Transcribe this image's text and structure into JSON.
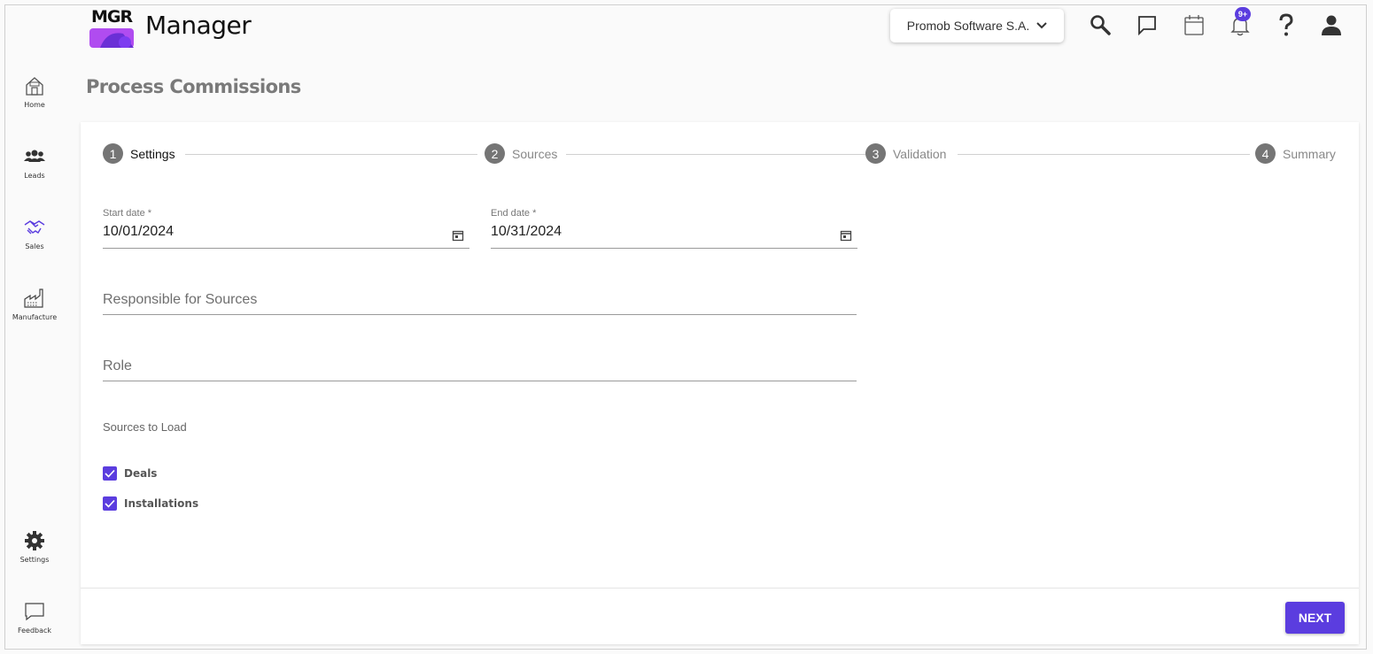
{
  "app": {
    "logo_text": "MGR",
    "title": "Manager"
  },
  "header": {
    "company": "Promob Software S.A.",
    "notification_badge": "9+"
  },
  "sidebar": {
    "items": [
      {
        "label": "Home",
        "icon": "home-icon"
      },
      {
        "label": "Leads",
        "icon": "people-icon"
      },
      {
        "label": "Sales",
        "icon": "handshake-icon"
      },
      {
        "label": "Manufacture",
        "icon": "factory-icon"
      },
      {
        "label": "Settings",
        "icon": "gear-icon"
      },
      {
        "label": "Feedback",
        "icon": "chat-bubble-icon"
      }
    ]
  },
  "page": {
    "title": "Process Commissions"
  },
  "stepper": {
    "steps": [
      {
        "number": "1",
        "label": "Settings",
        "active": true
      },
      {
        "number": "2",
        "label": "Sources",
        "active": false
      },
      {
        "number": "3",
        "label": "Validation",
        "active": false
      },
      {
        "number": "4",
        "label": "Summary",
        "active": false
      }
    ]
  },
  "form": {
    "start_date": {
      "label": "Start date *",
      "value": "10/01/2024"
    },
    "end_date": {
      "label": "End date *",
      "value": "10/31/2024"
    },
    "responsible": {
      "placeholder": "Responsible for Sources"
    },
    "role": {
      "placeholder": "Role"
    },
    "sources_label": "Sources to Load",
    "sources": [
      {
        "label": "Deals",
        "checked": true
      },
      {
        "label": "Installations",
        "checked": true
      }
    ]
  },
  "actions": {
    "next_label": "NEXT"
  },
  "colors": {
    "accent": "#5b3ddf",
    "step_circle": "#757575"
  }
}
